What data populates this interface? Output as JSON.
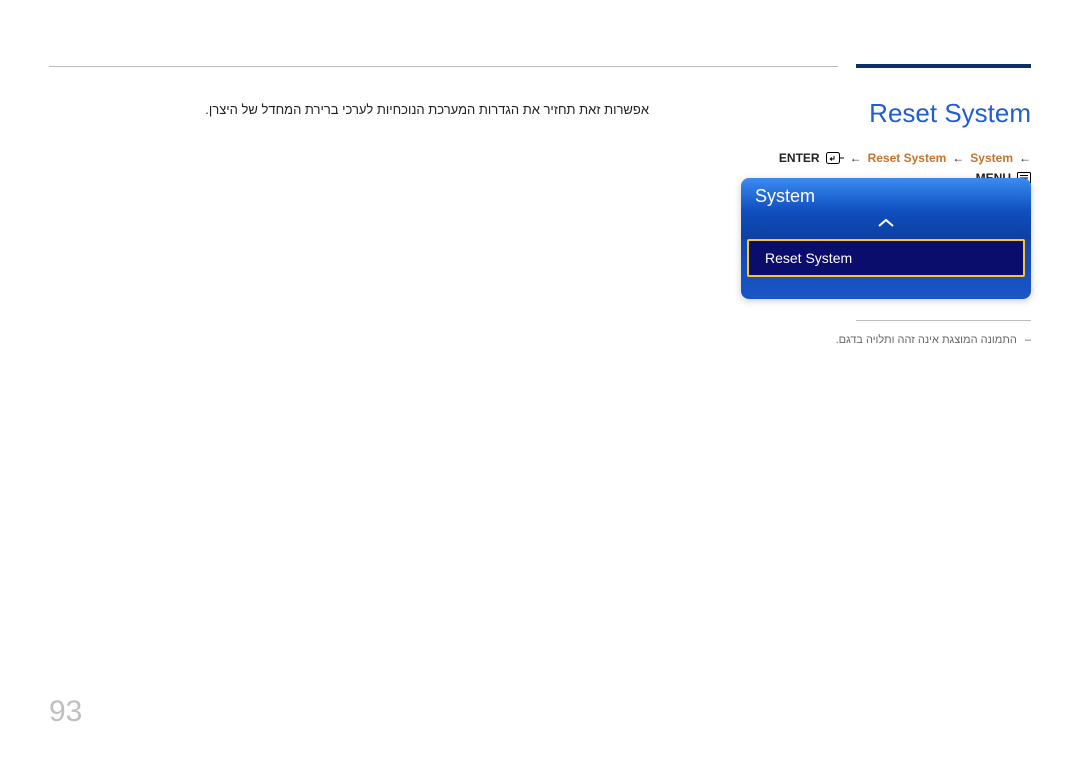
{
  "title": "Reset System",
  "breadcrumb": {
    "enter_label": "ENTER",
    "step1": "Reset System",
    "step2": "System",
    "menu_label": "MENU"
  },
  "osd": {
    "header": "System",
    "selected_item": "Reset System"
  },
  "description": "אפשרות זאת תחזיר את הגדרות המערכת הנוכחיות לערכי ברירת המחדל של היצרן.",
  "footnote": "התמונה המוצגת אינה זהה ותלויה בדגם.",
  "page_number": "93"
}
